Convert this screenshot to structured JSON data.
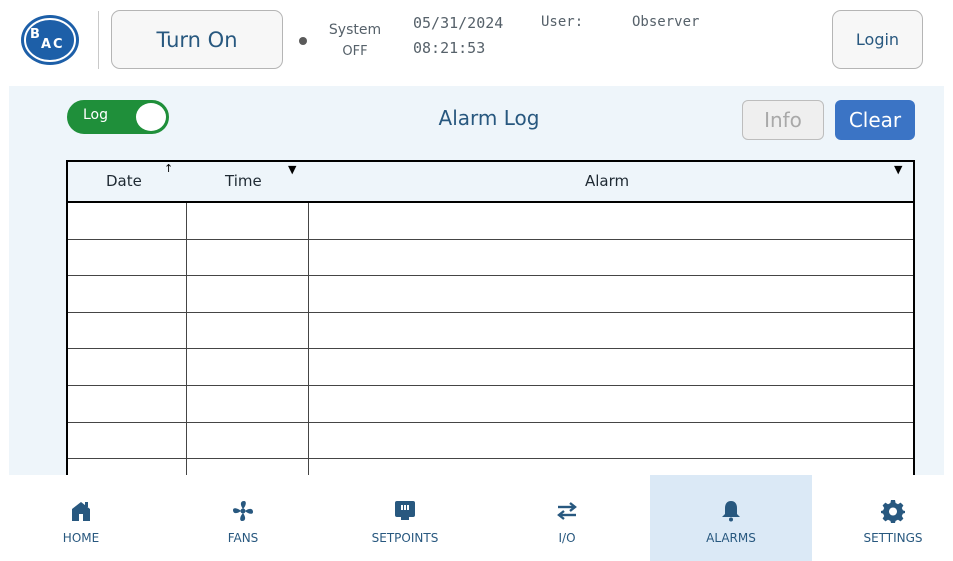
{
  "header": {
    "turn_on_label": "Turn On",
    "system_label": "System",
    "system_state": "OFF",
    "date": "05/31/2024",
    "time": "08:21:53",
    "user_label": "User:",
    "user_value": "Observer",
    "login_label": "Login",
    "logo_icon": "bac-logo",
    "status_dot_color": "#5a5a5a"
  },
  "main": {
    "toggle_label": "Log",
    "toggle_on": true,
    "title": "Alarm Log",
    "info_label": "Info",
    "clear_label": "Clear",
    "accent_color": "#3b74c5",
    "toggle_color": "#1f8f3a"
  },
  "table": {
    "columns": [
      {
        "label": "Date",
        "sort_icon": "sort-up-icon"
      },
      {
        "label": "Time",
        "sort_icon": "sort-down-icon"
      },
      {
        "label": "Alarm",
        "sort_icon": "sort-down-icon"
      }
    ],
    "rows": [
      {
        "date": "",
        "time": "",
        "alarm": ""
      },
      {
        "date": "",
        "time": "",
        "alarm": ""
      },
      {
        "date": "",
        "time": "",
        "alarm": ""
      },
      {
        "date": "",
        "time": "",
        "alarm": ""
      },
      {
        "date": "",
        "time": "",
        "alarm": ""
      },
      {
        "date": "",
        "time": "",
        "alarm": ""
      },
      {
        "date": "",
        "time": "",
        "alarm": ""
      },
      {
        "date": "",
        "time": "",
        "alarm": ""
      }
    ]
  },
  "nav": {
    "items": [
      {
        "label": "HOME",
        "icon": "home-icon"
      },
      {
        "label": "FANS",
        "icon": "fan-icon"
      },
      {
        "label": "SETPOINTS",
        "icon": "setpoints-icon"
      },
      {
        "label": "I/O",
        "icon": "io-arrows-icon"
      },
      {
        "label": "ALARMS",
        "icon": "bell-icon",
        "active": true
      },
      {
        "label": "SETTINGS",
        "icon": "gear-icon"
      }
    ],
    "active_color": "#dbe9f6"
  }
}
